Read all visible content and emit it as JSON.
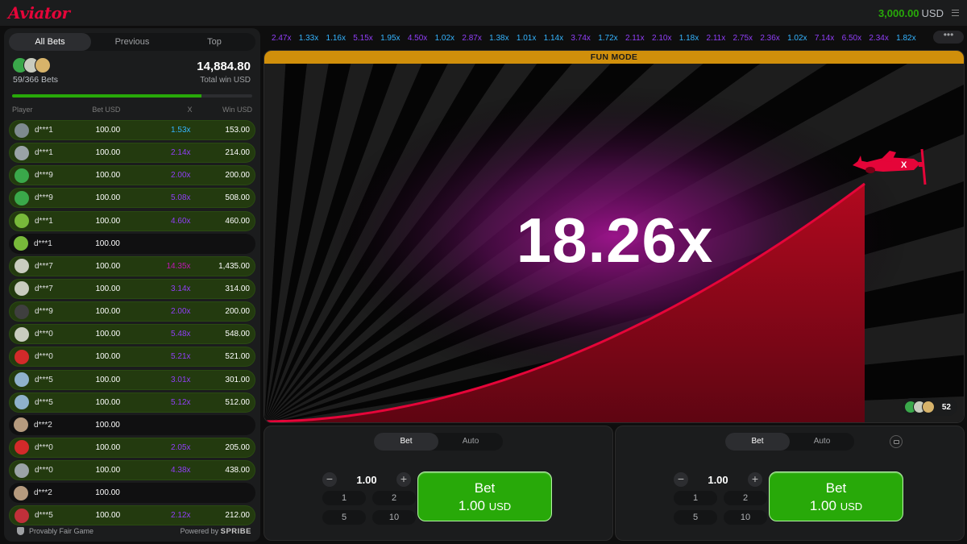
{
  "header": {
    "logo": "Aviator",
    "balance_amount": "3,000.00",
    "balance_currency": "USD"
  },
  "left_panel": {
    "tabs": [
      "All Bets",
      "Previous",
      "Top"
    ],
    "active_tab": "All Bets",
    "bets_count": "59/366 Bets",
    "total_win": "14,884.80",
    "total_win_label": "Total win USD",
    "progress_fraction": 0.79,
    "columns": [
      "Player",
      "Bet USD",
      "X",
      "Win USD"
    ],
    "rows": [
      {
        "player": "d***1",
        "bet": "100.00",
        "x": "1.53x",
        "win": "153.00",
        "x_color": "#34b4ff",
        "avatar_color": "#7e8a8f"
      },
      {
        "player": "d***1",
        "bet": "100.00",
        "x": "2.14x",
        "win": "214.00",
        "x_color": "#913ef8",
        "avatar_color": "#9aa3a7"
      },
      {
        "player": "d***9",
        "bet": "100.00",
        "x": "2.00x",
        "win": "200.00",
        "x_color": "#913ef8",
        "avatar_color": "#3aa84a"
      },
      {
        "player": "d***9",
        "bet": "100.00",
        "x": "5.08x",
        "win": "508.00",
        "x_color": "#913ef8",
        "avatar_color": "#3aa84a"
      },
      {
        "player": "d***1",
        "bet": "100.00",
        "x": "4.60x",
        "win": "460.00",
        "x_color": "#913ef8",
        "avatar_color": "#78b93a"
      },
      {
        "player": "d***1",
        "bet": "100.00",
        "x": "",
        "win": "",
        "x_color": "#913ef8",
        "avatar_color": "#78b93a"
      },
      {
        "player": "d***7",
        "bet": "100.00",
        "x": "14.35x",
        "win": "1,435.00",
        "x_color": "#c017b4",
        "avatar_color": "#c9ccbf"
      },
      {
        "player": "d***7",
        "bet": "100.00",
        "x": "3.14x",
        "win": "314.00",
        "x_color": "#913ef8",
        "avatar_color": "#c9ccbf"
      },
      {
        "player": "d***9",
        "bet": "100.00",
        "x": "2.00x",
        "win": "200.00",
        "x_color": "#913ef8",
        "avatar_color": "#3f3f3f"
      },
      {
        "player": "d***0",
        "bet": "100.00",
        "x": "5.48x",
        "win": "548.00",
        "x_color": "#913ef8",
        "avatar_color": "#c9ccbf"
      },
      {
        "player": "d***0",
        "bet": "100.00",
        "x": "5.21x",
        "win": "521.00",
        "x_color": "#913ef8",
        "avatar_color": "#d32a2a"
      },
      {
        "player": "d***5",
        "bet": "100.00",
        "x": "3.01x",
        "win": "301.00",
        "x_color": "#913ef8",
        "avatar_color": "#8fb2cc"
      },
      {
        "player": "d***5",
        "bet": "100.00",
        "x": "5.12x",
        "win": "512.00",
        "x_color": "#913ef8",
        "avatar_color": "#8fb2cc"
      },
      {
        "player": "d***2",
        "bet": "100.00",
        "x": "",
        "win": "",
        "x_color": "#913ef8",
        "avatar_color": "#b59a7e"
      },
      {
        "player": "d***0",
        "bet": "100.00",
        "x": "2.05x",
        "win": "205.00",
        "x_color": "#913ef8",
        "avatar_color": "#d32a2a"
      },
      {
        "player": "d***0",
        "bet": "100.00",
        "x": "4.38x",
        "win": "438.00",
        "x_color": "#913ef8",
        "avatar_color": "#9aa3a7"
      },
      {
        "player": "d***2",
        "bet": "100.00",
        "x": "",
        "win": "",
        "x_color": "#913ef8",
        "avatar_color": "#b59a7e"
      },
      {
        "player": "d***5",
        "bet": "100.00",
        "x": "2.12x",
        "win": "212.00",
        "x_color": "#913ef8",
        "avatar_color": "#c0303a"
      }
    ],
    "footer_left": "Provably Fair Game",
    "footer_right_prefix": "Powered by",
    "footer_right_brand": "SPRIBE"
  },
  "history": [
    {
      "v": "2.47x",
      "c": "#913ef8"
    },
    {
      "v": "1.33x",
      "c": "#34b4ff"
    },
    {
      "v": "1.16x",
      "c": "#34b4ff"
    },
    {
      "v": "5.15x",
      "c": "#913ef8"
    },
    {
      "v": "1.95x",
      "c": "#34b4ff"
    },
    {
      "v": "4.50x",
      "c": "#913ef8"
    },
    {
      "v": "1.02x",
      "c": "#34b4ff"
    },
    {
      "v": "2.87x",
      "c": "#913ef8"
    },
    {
      "v": "1.38x",
      "c": "#34b4ff"
    },
    {
      "v": "1.01x",
      "c": "#34b4ff"
    },
    {
      "v": "1.14x",
      "c": "#34b4ff"
    },
    {
      "v": "3.74x",
      "c": "#913ef8"
    },
    {
      "v": "1.72x",
      "c": "#34b4ff"
    },
    {
      "v": "2.11x",
      "c": "#913ef8"
    },
    {
      "v": "2.10x",
      "c": "#913ef8"
    },
    {
      "v": "1.18x",
      "c": "#34b4ff"
    },
    {
      "v": "2.11x",
      "c": "#913ef8"
    },
    {
      "v": "2.75x",
      "c": "#913ef8"
    },
    {
      "v": "2.36x",
      "c": "#913ef8"
    },
    {
      "v": "1.02x",
      "c": "#34b4ff"
    },
    {
      "v": "7.14x",
      "c": "#913ef8"
    },
    {
      "v": "6.50x",
      "c": "#913ef8"
    },
    {
      "v": "2.34x",
      "c": "#913ef8"
    },
    {
      "v": "1.82x",
      "c": "#34b4ff"
    }
  ],
  "history_more": "•••",
  "game": {
    "mode_label": "FUN MODE",
    "multiplier": "18.26x",
    "players_online": "52",
    "plane_label": "X"
  },
  "bet_panels": [
    {
      "tabs": [
        "Bet",
        "Auto"
      ],
      "amount": "1.00",
      "quick": [
        "1",
        "2",
        "5",
        "10"
      ],
      "button_label": "Bet",
      "button_amount": "1.00",
      "button_currency": "USD",
      "minus": "−",
      "plus": "+"
    },
    {
      "tabs": [
        "Bet",
        "Auto"
      ],
      "amount": "1.00",
      "quick": [
        "1",
        "2",
        "5",
        "10"
      ],
      "button_label": "Bet",
      "button_amount": "1.00",
      "button_currency": "USD",
      "minus": "−",
      "plus": "+"
    }
  ],
  "colors": {
    "brand_red": "#e50539",
    "win_green": "#28a909",
    "fun_mode_gold": "#d08f0b",
    "curve_red": "#e50539"
  }
}
